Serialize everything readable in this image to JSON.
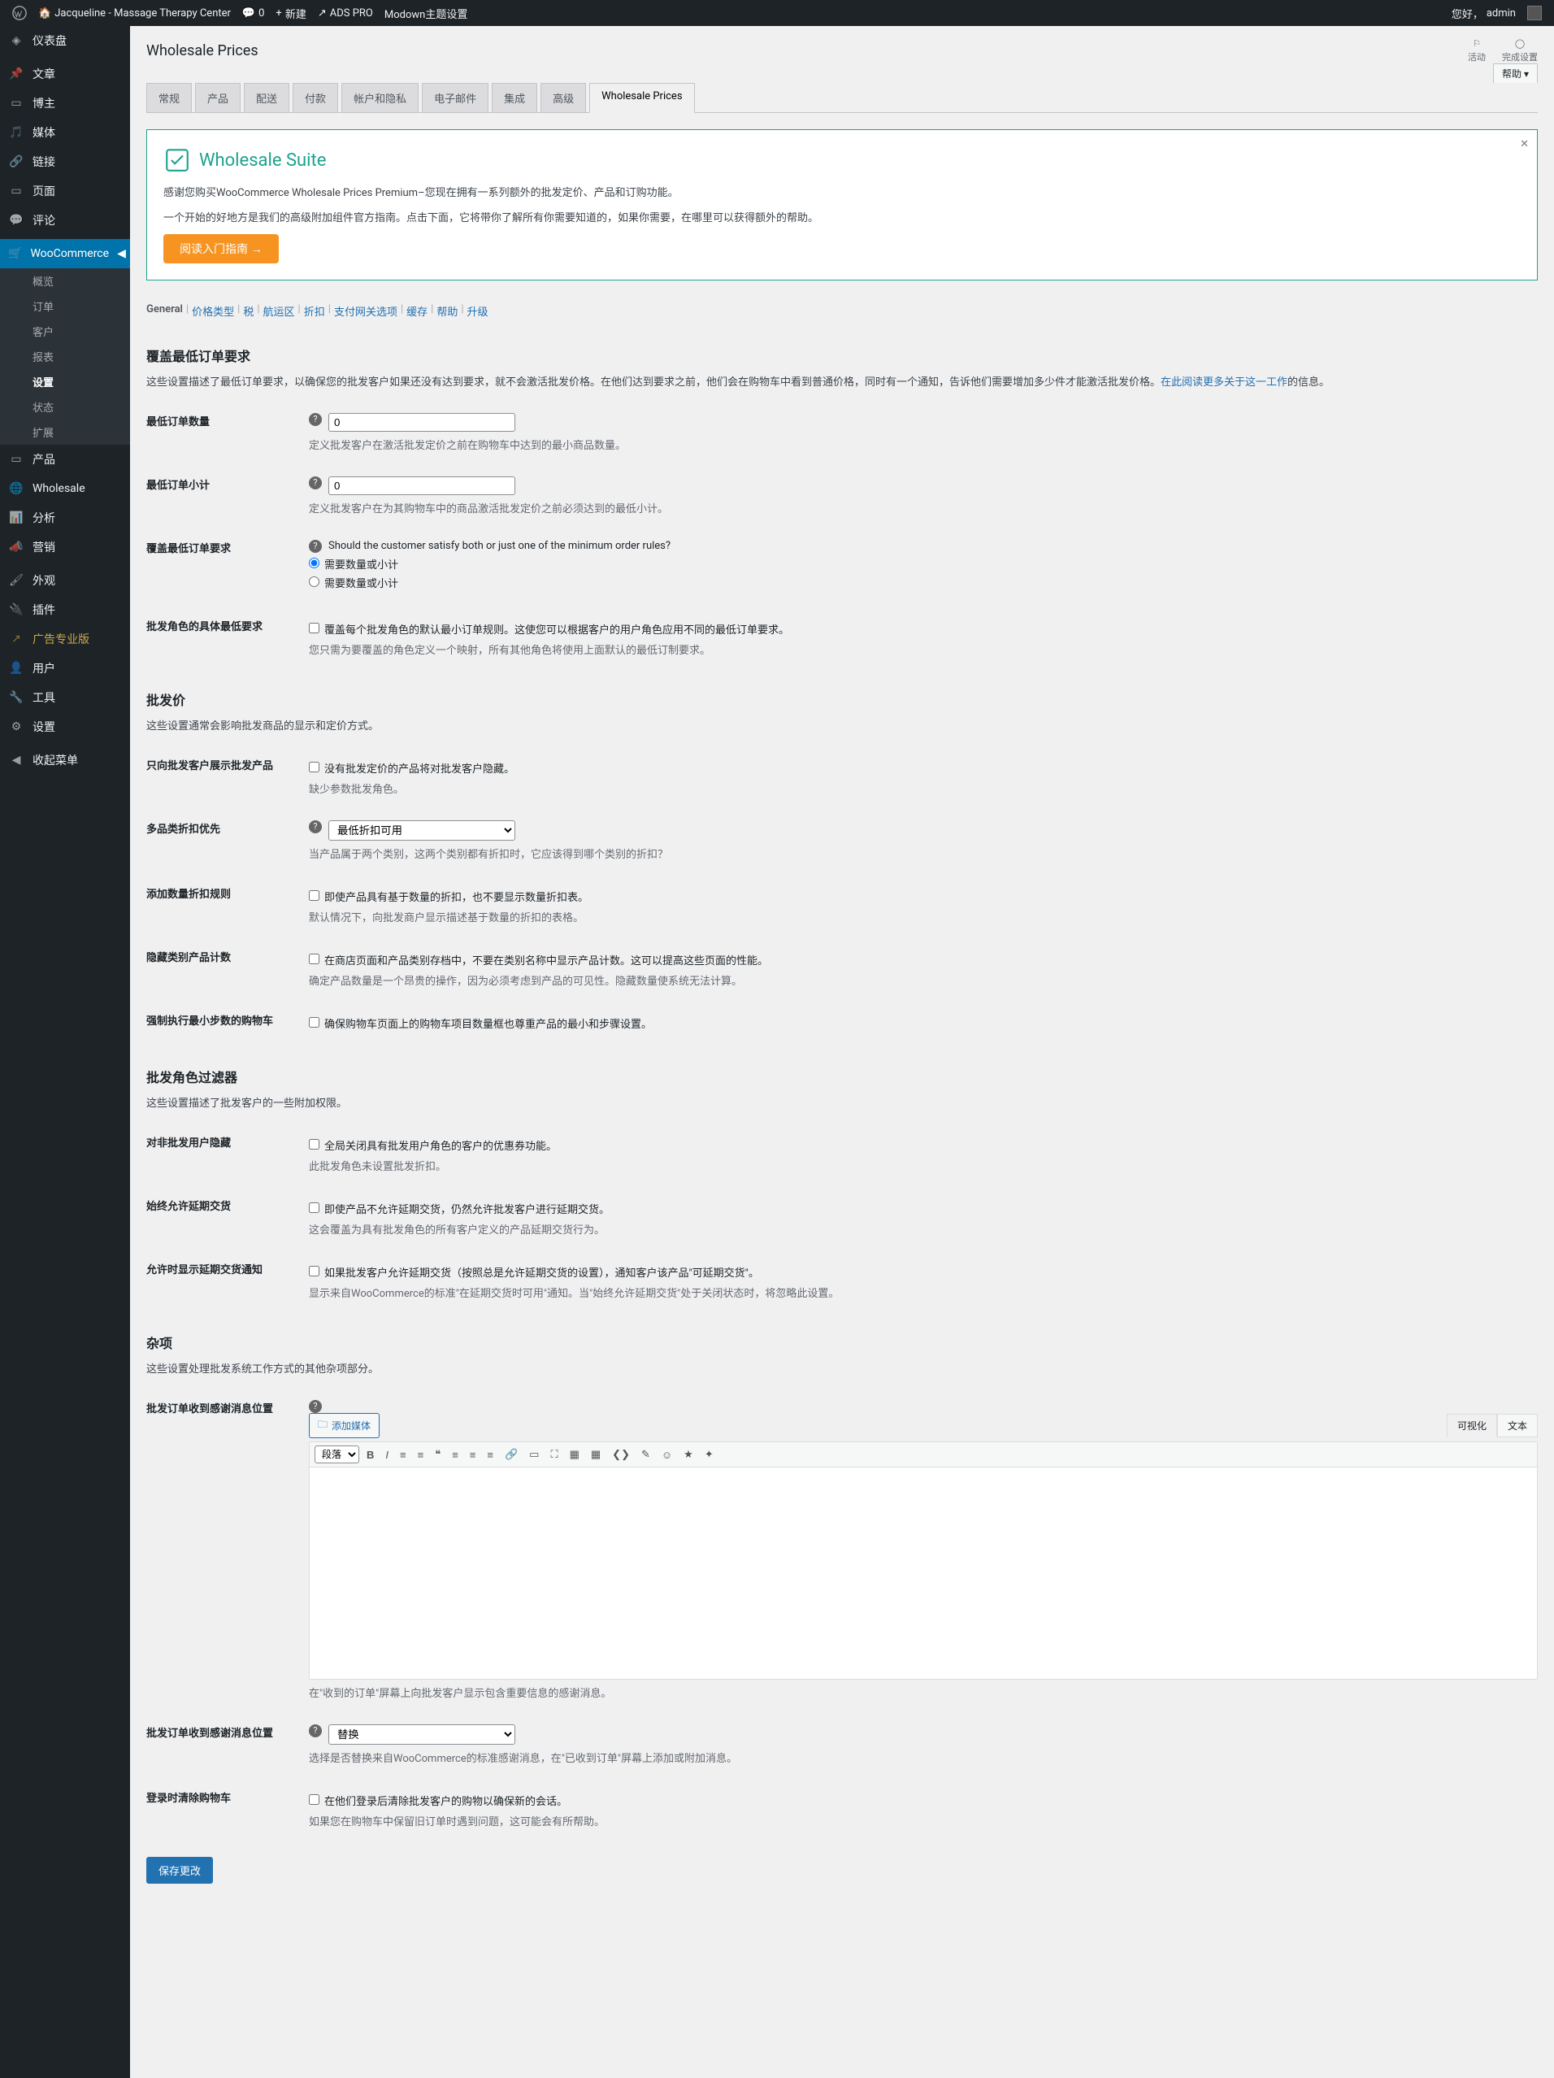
{
  "toolbar": {
    "site": "Jacqueline - Massage Therapy Center",
    "comments": "0",
    "new": "新建",
    "ads": "ADS PRO",
    "modown": "Modown主题设置",
    "greeting": "您好，",
    "user": "admin"
  },
  "menu": {
    "dashboard": "仪表盘",
    "posts": "文章",
    "blogger": "博主",
    "media": "媒体",
    "links": "链接",
    "pages": "页面",
    "comments": "评论",
    "woo": "WooCommerce",
    "woo_sub": {
      "home": "概览",
      "orders": "订单",
      "customers": "客户",
      "reports": "报表",
      "settings": "设置",
      "status": "状态",
      "extensions": "扩展"
    },
    "products": "产品",
    "wholesale": "Wholesale",
    "analytics": "分析",
    "marketing": "营销",
    "appearance": "外观",
    "plugins": "插件",
    "ads_pro": "广告专业版",
    "users": "用户",
    "tools": "工具",
    "settings2": "设置",
    "collapse": "收起菜单"
  },
  "header": {
    "title": "Wholesale Prices",
    "activity": "活动",
    "finish_setup": "完成设置",
    "help": "帮助"
  },
  "tabs": [
    "常规",
    "产品",
    "配送",
    "付款",
    "帐户和隐私",
    "电子邮件",
    "集成",
    "高级",
    "Wholesale Prices"
  ],
  "banner": {
    "brand": "Wholesale Suite",
    "p1": "感谢您购买WooCommerce Wholesale Prices Premium–您现在拥有一系列额外的批发定价、产品和订购功能。",
    "p2": "一个开始的好地方是我们的高级附加组件官方指南。点击下面，它将带你了解所有你需要知道的，如果你需要，在哪里可以获得额外的帮助。",
    "btn": "阅读入门指南 →"
  },
  "subtabs": [
    "General",
    "价格类型",
    "税",
    "航运区",
    "折扣",
    "支付网关选项",
    "缓存",
    "帮助",
    "升级"
  ],
  "s1": {
    "title": "覆盖最低订单要求",
    "desc1": "这些设置描述了最低订单要求，以确保您的批发客户如果还没有达到要求，就不会激活批发价格。在他们达到要求之前，他们会在购物车中看到普通价格，同时有一个通知，告诉他们需要增加多少件才能激活批发价格。",
    "desc_link": "在此阅读更多关于这一工作",
    "desc2": "的信息。",
    "min_qty": "最低订单数量",
    "min_qty_desc": "定义批发客户在激活批发定价之前在购物车中达到的最小商品数量。",
    "min_subtotal": "最低订单小计",
    "min_subtotal_desc": "定义批发客户在为其购物车中的商品激活批发定价之前必须达到的最低小计。",
    "min_req": "覆盖最低订单要求",
    "min_req_q": "Should the customer satisfy both or just one of the minimum order rules?",
    "opt1": "需要数量或小计",
    "opt2": "需要数量或小计",
    "role_override": "批发角色的具体最低要求",
    "role_override_cb": "覆盖每个批发角色的默认最小订单规则。这使您可以根据客户的用户角色应用不同的最低订单要求。",
    "role_override_desc": "您只需为要覆盖的角色定义一个映射，所有其他角色将使用上面默认的最低订制要求。"
  },
  "s2": {
    "title": "批发价",
    "desc": "这些设置通常会影响批发商品的显示和定价方式。",
    "only_show": "只向批发客户展示批发产品",
    "only_show_cb": "没有批发定价的产品将对批发客户隐藏。",
    "only_show_desc": "缺少参数批发角色。",
    "multi_cat": "多品类折扣优先",
    "multi_cat_select": "最低折扣可用",
    "multi_cat_desc": "当产品属于两个类别，这两个类别都有折扣时，它应该得到哪个类别的折扣？",
    "add_qty": "添加数量折扣规则",
    "add_qty_cb": "即使产品具有基于数量的折扣，也不要显示数量折扣表。",
    "add_qty_desc": "默认情况下，向批发商户显示描述基于数量的折扣的表格。",
    "hide_count": "隐藏类别产品计数",
    "hide_count_cb": "在商店页面和产品类别存档中，不要在类别名称中显示产品计数。这可以提高这些页面的性能。",
    "hide_count_desc": "确定产品数量是一个昂贵的操作，因为必须考虑到产品的可见性。隐藏数量使系统无法计算。",
    "force_step": "强制执行最小步数的购物车",
    "force_step_cb": "确保购物车页面上的购物车项目数量框也尊重产品的最小和步骤设置。"
  },
  "s3": {
    "title": "批发角色过滤器",
    "desc": "这些设置描述了批发客户的一些附加权限。",
    "hide_coupon": "对非批发用户隐藏",
    "hide_coupon_cb": "全局关闭具有批发用户角色的客户的优惠券功能。",
    "hide_coupon_desc": "此批发角色未设置批发折扣。",
    "always_backorder": "始终允许延期交货",
    "always_backorder_cb": "即使产品不允许延期交货，仍然允许批发客户进行延期交货。",
    "always_backorder_desc": "这会覆盖为具有批发角色的所有客户定义的产品延期交货行为。",
    "show_backorder": "允许时显示延期交货通知",
    "show_backorder_cb": "如果批发客户允许延期交货（按照总是允许延期交货的设置），通知客户该产品\"可延期交货\"。",
    "show_backorder_desc": "显示来自WooCommerce的标准\"在延期交货时可用\"通知。当\"始终允许延期交货\"处于关闭状态时，将忽略此设置。"
  },
  "s4": {
    "title": "杂项",
    "desc": "这些设置处理批发系统工作方式的其他杂项部分。",
    "msg_pos": "批发订单收到感谢消息位置",
    "add_media": "添加媒体",
    "visual": "可视化",
    "text": "文本",
    "paragraph": "段落",
    "msg_pos_desc": "在\"收到的订单\"屏幕上向批发客户显示包含重要信息的感谢消息。",
    "msg_pos2": "批发订单收到感谢消息位置",
    "replace_opt": "替换",
    "msg_pos2_desc": "选择是否替换来自WooCommerce的标准感谢消息，在\"已收到订单\"屏幕上添加或附加消息。",
    "clear_cart": "登录时清除购物车",
    "clear_cart_cb": "在他们登录后清除批发客户的购物以确保新的会话。",
    "clear_cart_desc": "如果您在购物车中保留旧订单时遇到问题，这可能会有所帮助。",
    "save": "保存更改"
  }
}
